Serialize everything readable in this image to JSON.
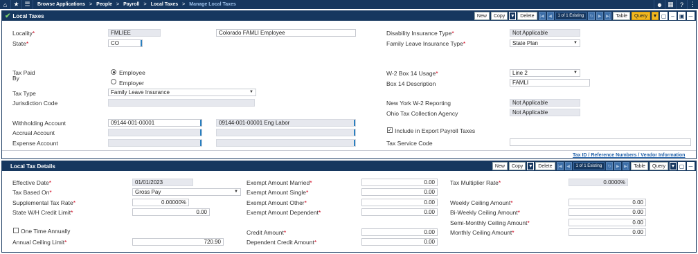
{
  "breadcrumb": [
    "Browse Applications",
    "People",
    "Payroll",
    "Local Taxes",
    "Manage Local Taxes"
  ],
  "panel1": {
    "title": "Local Taxes",
    "toolbar": {
      "new": "New",
      "copy": "Copy",
      "delete": "Delete",
      "records": "1 of 1 Existing",
      "table": "Table",
      "query": "Query"
    },
    "locality_label": "Locality",
    "locality_value": "FMLIEE",
    "locality_desc": "Colorado FAMLI Employee",
    "state_label": "State",
    "state_value": "CO",
    "tax_paid_by_label_1": "Tax Paid",
    "tax_paid_by_label_2": "By",
    "tax_paid_by_employee": "Employee",
    "tax_paid_by_employer": "Employer",
    "tax_type_label": "Tax Type",
    "tax_type_value": "Family Leave Insurance",
    "jurisdiction_label": "Jurisdiction Code",
    "jurisdiction_value": "",
    "withholding_label": "Withholding Account",
    "withholding_value": "09144-001-00001",
    "withholding_desc": "09144-001-00001 Eng Labor",
    "accrual_label": "Accrual Account",
    "accrual_value": "",
    "expense_label": "Expense Account",
    "expense_value": "",
    "disability_label": "Disability Insurance Type",
    "disability_value": "Not Applicable",
    "family_leave_label": "Family Leave Insurance Type",
    "family_leave_value": "State Plan",
    "w2_box14_label": "W-2 Box 14 Usage",
    "w2_box14_value": "Line 2",
    "box14_desc_label": "Box 14 Description",
    "box14_desc_value": "FAMLI",
    "ny_w2_label": "New York W-2 Reporting",
    "ny_w2_value": "Not Applicable",
    "ohio_label": "Ohio Tax Collection Agency",
    "ohio_value": "Not Applicable",
    "include_export_label": "Include in Export Payroll Taxes",
    "tax_service_label": "Tax Service Code",
    "tax_service_value": "",
    "tax_id_link": "Tax ID / Reference Numbers / Vendor Information"
  },
  "panel2": {
    "title": "Local Tax Details",
    "toolbar": {
      "new": "New",
      "copy": "Copy",
      "delete": "Delete",
      "records": "1 of 1 Existing",
      "table": "Table",
      "query": "Query"
    },
    "effective_date_label": "Effective Date",
    "effective_date_value": "01/01/2023",
    "tax_based_on_label": "Tax Based On",
    "tax_based_on_value": "Gross Pay",
    "supplemental_label": "Supplemental Tax Rate",
    "supplemental_value": "0.00000%",
    "state_wh_label": "State W/H Credit Limit",
    "state_wh_value": "0.00",
    "one_time_label": "One Time Annually",
    "annual_ceiling_label": "Annual Ceiling Limit",
    "annual_ceiling_value": "720.90",
    "exempt_married_label": "Exempt Amount Married",
    "exempt_married_value": "0.00",
    "exempt_single_label": "Exempt Amount Single",
    "exempt_single_value": "0.00",
    "exempt_other_label": "Exempt Amount Other",
    "exempt_other_value": "0.00",
    "exempt_dependent_label": "Exempt Amount Dependent",
    "exempt_dependent_value": "0.00",
    "credit_amount_label": "Credit Amount",
    "credit_amount_value": "0.00",
    "dependent_credit_label": "Dependent Credit Amount",
    "dependent_credit_value": "0.00",
    "tax_multiplier_label": "Tax Multiplier Rate",
    "tax_multiplier_value": "0.0000%",
    "weekly_label": "Weekly Ceiling Amount",
    "weekly_value": "0.00",
    "biweekly_label": "Bi-Weekly Ceiling Amount",
    "biweekly_value": "0.00",
    "semimonthly_label": "Semi-Monthly Ceiling Amount",
    "semimonthly_value": "0.00",
    "monthly_label": "Monthly Ceiling Amount",
    "monthly_value": "0.00"
  }
}
